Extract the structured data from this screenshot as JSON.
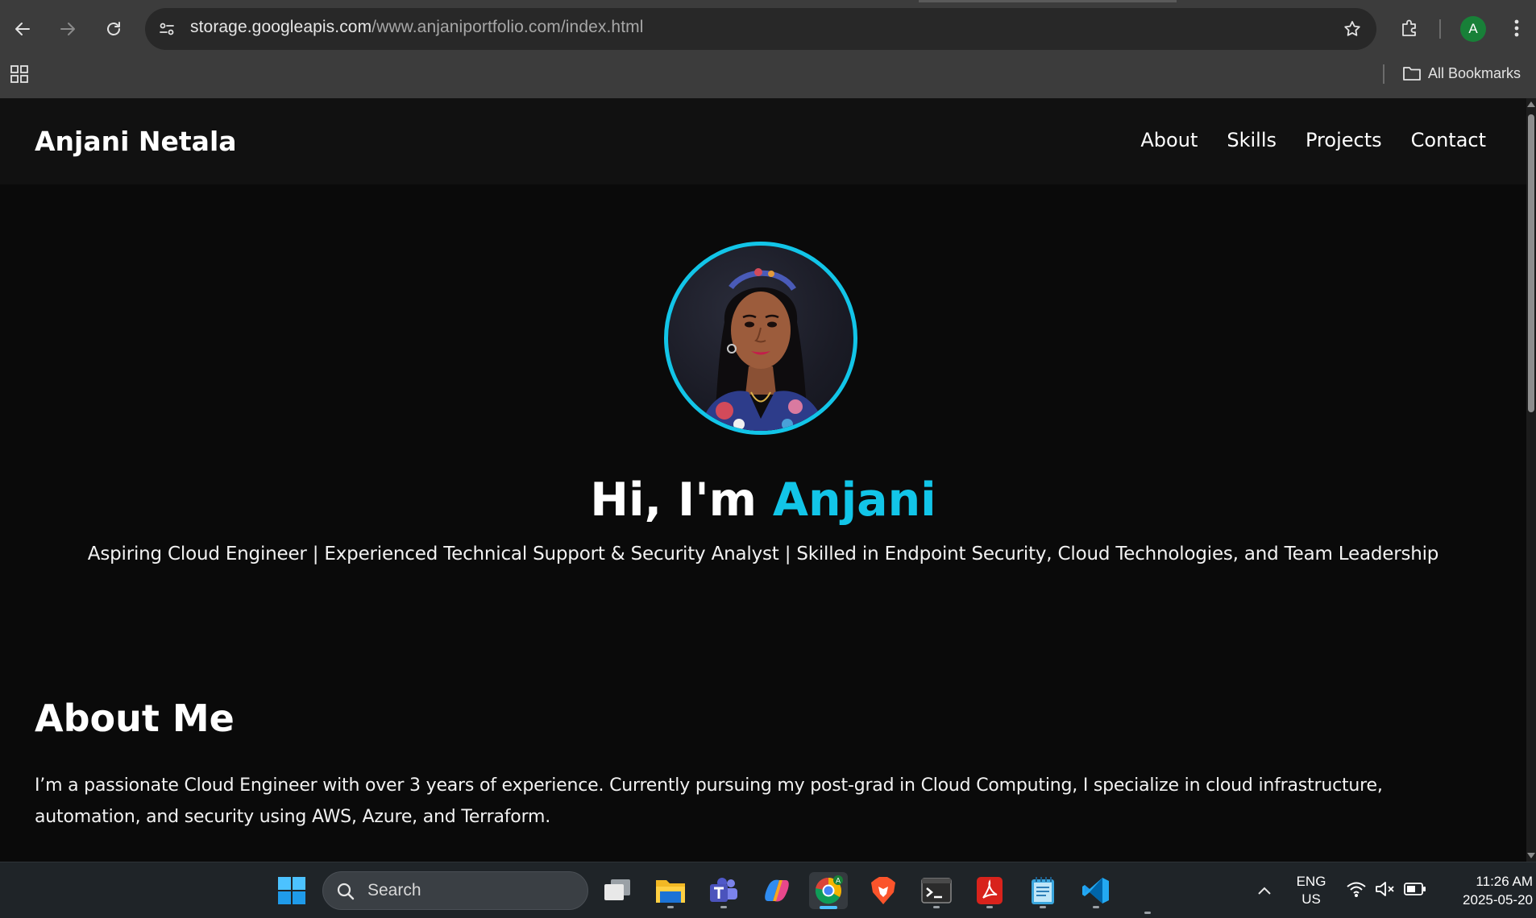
{
  "browser": {
    "url_host": "storage.googleapis.com",
    "url_path": "/www.anjaniportfolio.com/index.html",
    "profile_initial": "A",
    "all_bookmarks_label": "All Bookmarks",
    "profile_color": "#188038"
  },
  "site": {
    "logo": "Anjani Netala",
    "nav": {
      "about": "About",
      "skills": "Skills",
      "projects": "Projects",
      "contact": "Contact"
    },
    "hero": {
      "greeting": "Hi, I'm ",
      "name": "Anjani",
      "subtitle": "Aspiring Cloud Engineer | Experienced Technical Support & Security Analyst | Skilled in Endpoint Security, Cloud Technologies, and Team Leadership"
    },
    "about": {
      "heading": "About Me",
      "text": "I’m a passionate Cloud Engineer with over 3 years of experience. Currently pursuing my post-grad in Cloud Computing, I specialize in cloud infrastructure, automation, and security using AWS, Azure, and Terraform."
    },
    "accent_color": "#12c5e8",
    "background_color": "#0a0a0a"
  },
  "taskbar": {
    "search_label": "Search",
    "language": "ENG",
    "region": "US",
    "time": "11:26 AM",
    "date": "2025-05-20",
    "pinned_apps": [
      "start-icon",
      "task-view-icon",
      "file-explorer-icon",
      "teams-icon",
      "copilot-icon",
      "chrome-icon",
      "brave-icon",
      "terminal-icon",
      "acrobat-icon",
      "notepad-icon",
      "vscode-icon"
    ]
  }
}
